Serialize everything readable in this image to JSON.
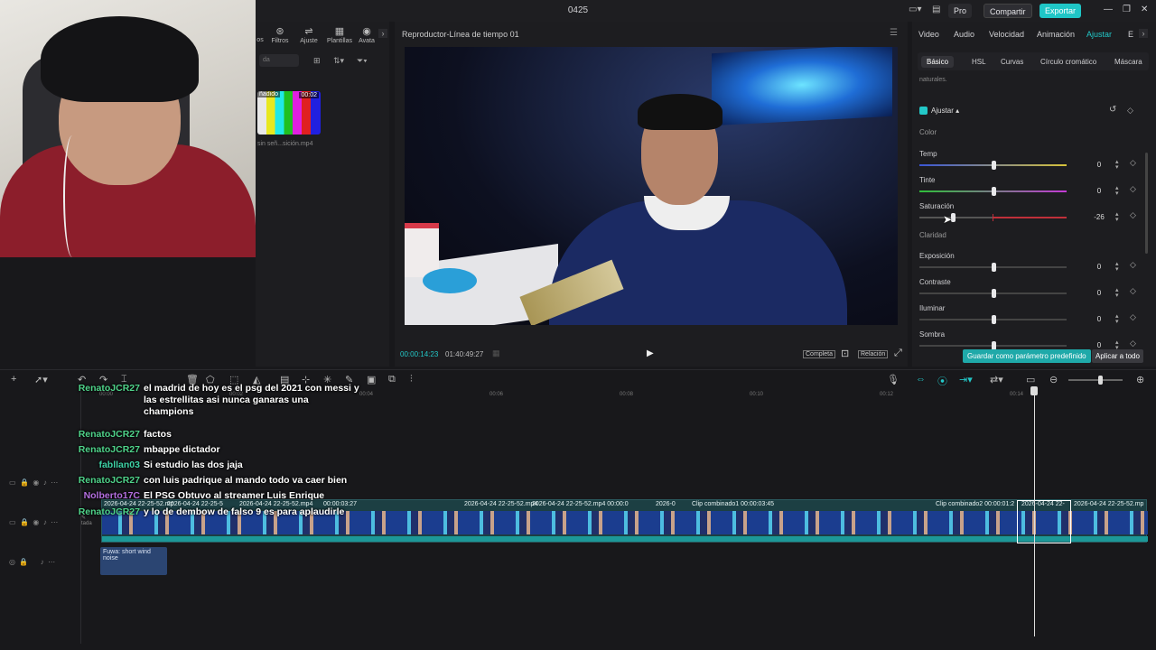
{
  "window": {
    "title": "0425",
    "pro": "Pro",
    "share": "Compartir",
    "export": "Exportar"
  },
  "media": {
    "tabs": [
      "os",
      "Filtros",
      "Ajuste",
      "Plantillas",
      "Avata"
    ],
    "search_placeholder": "da",
    "thumb_label": "ñadido",
    "thumb_duration": "00:02",
    "file_name": "sin señ...sición.mp4"
  },
  "player": {
    "title": "Reproductor-Línea de tiempo 01",
    "current_time": "00:00:14:23",
    "total_time": "01:40:49:27",
    "completa": "Completa",
    "ratio": "Relación"
  },
  "inspector": {
    "tabs": [
      "Video",
      "Audio",
      "Velocidad",
      "Animación",
      "Ajustar",
      "E"
    ],
    "active_tab": "Ajustar",
    "subtabs": [
      "Básico",
      "HSL",
      "Curvas",
      "Círculo cromático",
      "Máscara"
    ],
    "active_subtab": "Básico",
    "naturales": "naturales.",
    "ajustar_label": "Ajustar",
    "color_section": "Color",
    "claridad_section": "Claridad",
    "params": [
      {
        "label": "Temp",
        "value": "0",
        "level": 0.5
      },
      {
        "label": "Tinte",
        "value": "0",
        "level": 0.5
      },
      {
        "label": "Saturación",
        "value": "-26",
        "level": 0.23
      },
      {
        "label": "Exposición",
        "value": "0",
        "level": 0.5
      },
      {
        "label": "Contraste",
        "value": "0",
        "level": 0.5
      },
      {
        "label": "Iluminar",
        "value": "0",
        "level": 0.5
      },
      {
        "label": "Sombra",
        "value": "0",
        "level": 0.5
      }
    ],
    "save_preset": "Guardar como parámetro predefinido",
    "apply_all": "Aplicar a todo"
  },
  "timeline": {
    "ticks": [
      "00:00",
      "00:02",
      "00:04",
      "00:06",
      "00:08",
      "00:10",
      "00:12",
      "00:14"
    ],
    "clips": [
      "2026-04-24 22-25-52.mp",
      "2026-04-24 22-25-5",
      "2026-04-24 22-25-52.mp4",
      "00:00:03:27",
      "2026-04-24 22-25-52.mp4",
      "2026-04-24 22-25-52.mp4  00:00:0",
      "2026-0",
      "Clip combinado1  00:00:03:45",
      "Clip combinado2  00:00:01:2",
      "2026-04-24 22-",
      "2026-04-24 22-25-52.mp"
    ],
    "audio_clip": "Fuwa: short wind noise",
    "portada": "tada"
  },
  "chat": [
    {
      "user": "RenatoJCR27",
      "color": "#4fd38a",
      "msg": "el madrid de hoy es el psg del 2021 con messi y las estrellitas asi nunca ganaras una champions"
    },
    {
      "user": "RenatoJCR27",
      "color": "#4fd38a",
      "msg": "factos"
    },
    {
      "user": "RenatoJCR27",
      "color": "#4fd38a",
      "msg": "mbappe dictador"
    },
    {
      "user": "fabllan03",
      "color": "#3ed2a6",
      "msg": "Si estudio las dos jaja"
    },
    {
      "user": "RenatoJCR27",
      "color": "#4fd38a",
      "msg": "con luis padrique al mando todo va caer bien"
    },
    {
      "user": "Nolberto17C",
      "color": "#b46fe0",
      "msg": "El PSG Obtuvo al streamer Luis Enrique"
    },
    {
      "user": "RenatoJCR27",
      "color": "#4fd38a",
      "msg": "y lo de dembow de falso 9 es para aplaudirle"
    }
  ]
}
